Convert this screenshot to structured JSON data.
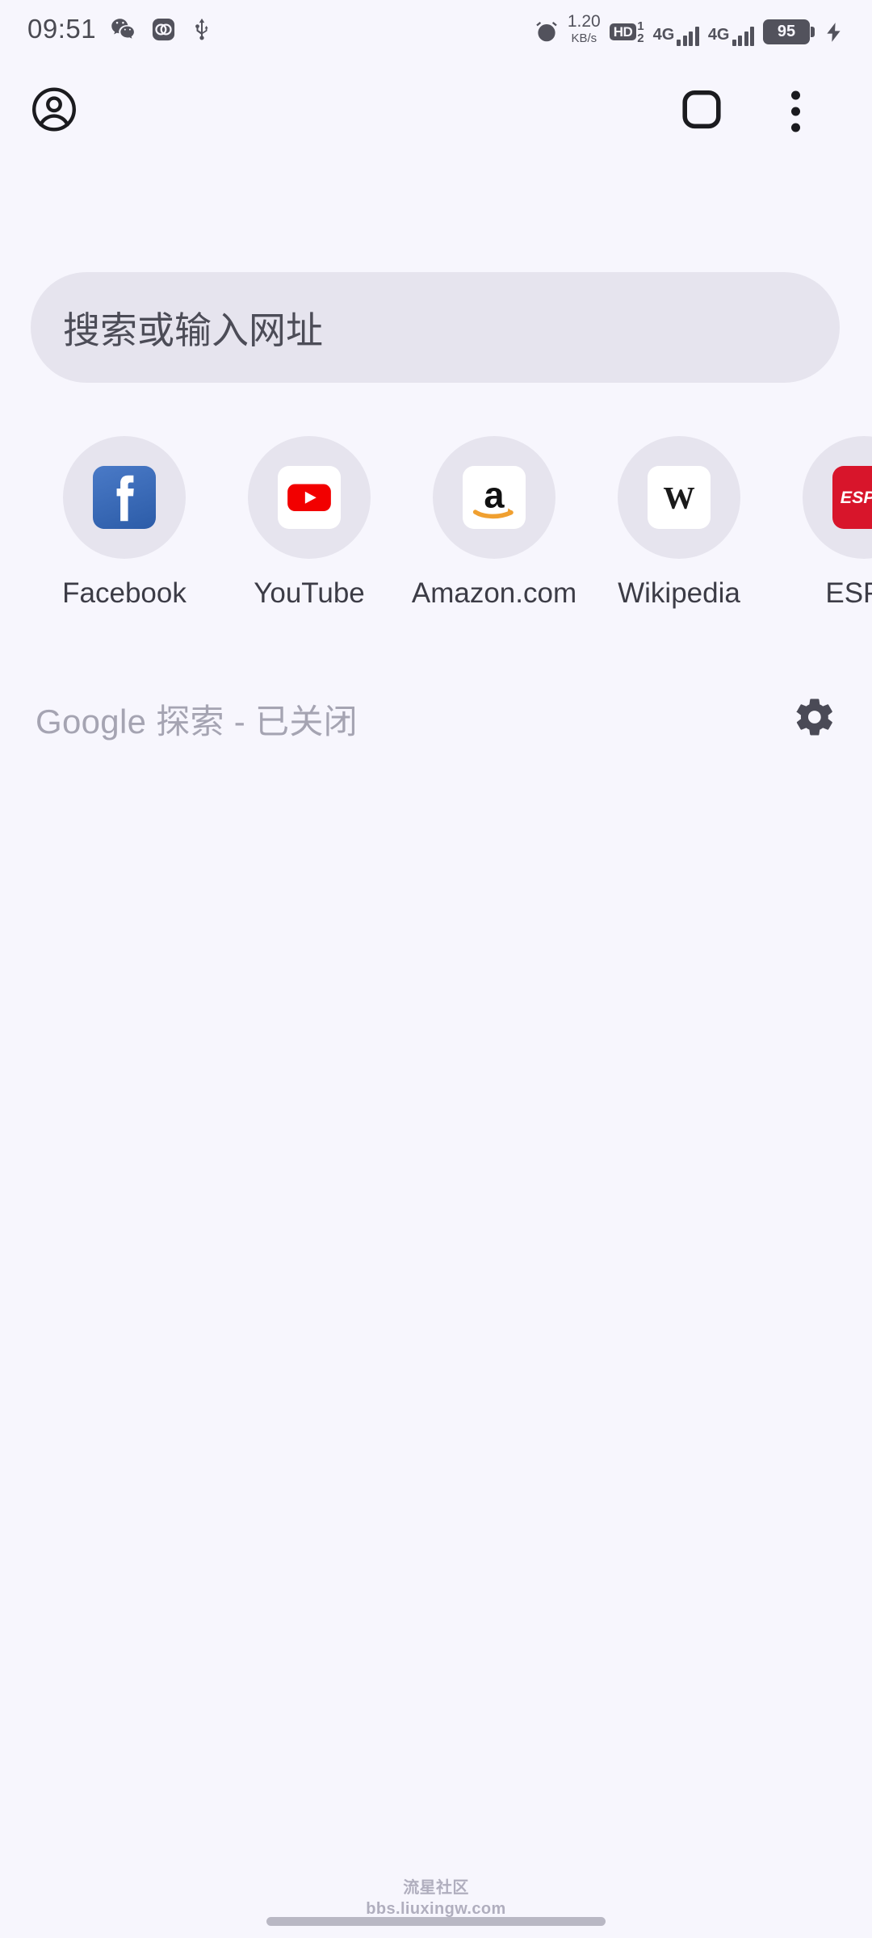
{
  "statusbar": {
    "clock": "09:51",
    "left_icons": [
      {
        "name": "wechat-icon",
        "label": "WeChat"
      },
      {
        "name": "app-icon",
        "label": "App"
      },
      {
        "name": "usb-icon",
        "label": "USB"
      }
    ],
    "alarm_icon": "alarm-icon",
    "network_speed": {
      "value": "1.20",
      "unit": "KB/s"
    },
    "hd_badge": {
      "label": "HD",
      "sub_top": "1",
      "sub_bottom": "2"
    },
    "sim1": {
      "network": "4G",
      "bars": 4
    },
    "sim2": {
      "network": "4G",
      "bars": 4
    },
    "battery": {
      "percent": "95",
      "charging": true
    }
  },
  "toolbar": {
    "account_label": "Account",
    "tab_switcher_label": "Tab switcher",
    "menu_label": "More options"
  },
  "search": {
    "placeholder": "搜索或输入网址",
    "value": ""
  },
  "shortcuts": [
    {
      "label": "Facebook",
      "icon": "facebook-icon",
      "glyph": "f",
      "style": "fb"
    },
    {
      "label": "YouTube",
      "icon": "youtube-icon",
      "glyph": "",
      "style": "yt"
    },
    {
      "label": "Amazon.com",
      "icon": "amazon-icon",
      "glyph": "a",
      "style": "amz"
    },
    {
      "label": "Wikipedia",
      "icon": "wikipedia-icon",
      "glyph": "W",
      "style": "wiki"
    },
    {
      "label": "ESPN",
      "icon": "espn-icon",
      "glyph": "ESPN",
      "style": "espn"
    }
  ],
  "discover": {
    "text": "Google 探索 - 已关闭",
    "settings_icon": "gear-icon"
  },
  "watermark": {
    "line1": "流星社区",
    "line2": "bbs.liuxingw.com"
  },
  "colors": {
    "background": "#f7f6fd",
    "search_bg": "#e6e4ee",
    "tile_bg": "#e6e4ee",
    "icon_dark": "#1b1b1f",
    "status_icon": "#52525c",
    "muted_text": "#a5a4b2"
  }
}
